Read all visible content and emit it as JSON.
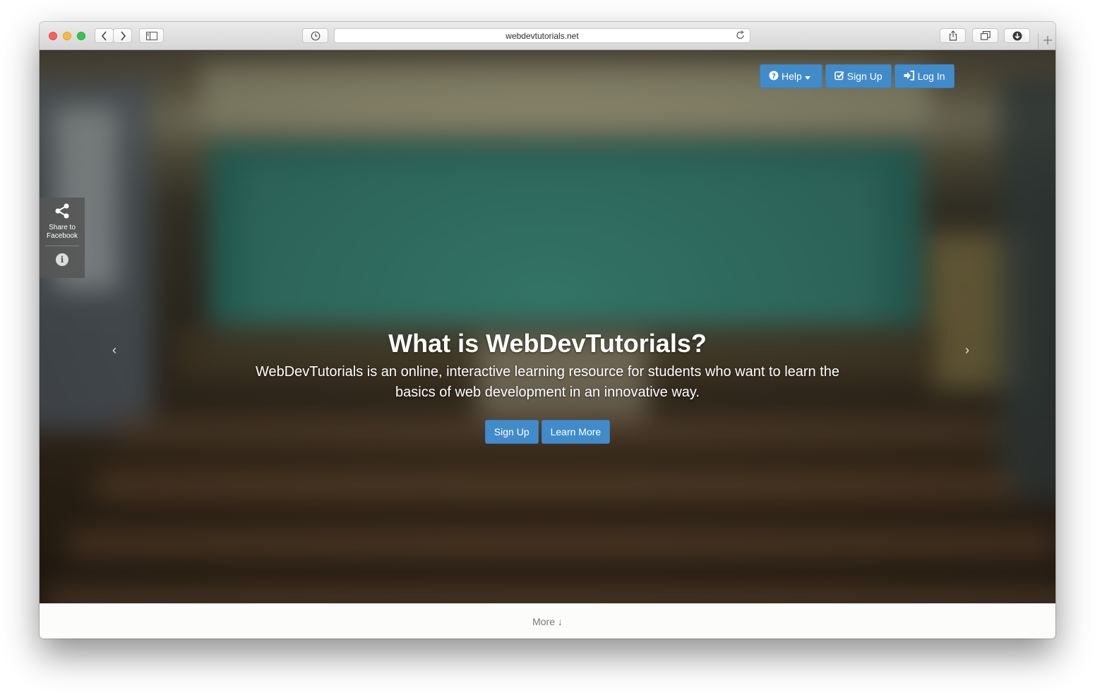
{
  "browser": {
    "url": "webdevtutorials.net",
    "traffic_lights": {
      "close": "#fc605c",
      "minimize": "#fdbc40",
      "zoom": "#34c84a"
    },
    "icons": [
      "back-icon",
      "forward-icon",
      "sidebar-icon",
      "history-icon",
      "reload-icon",
      "share-icon",
      "tabs-icon",
      "downloads-icon",
      "new-tab-icon"
    ]
  },
  "nav": {
    "help": "Help",
    "signup": "Sign Up",
    "login": "Log In"
  },
  "share": {
    "label_line1": "Share to",
    "label_line2": "Facebook",
    "info": "i"
  },
  "carousel": {
    "prev": "‹",
    "next": "›"
  },
  "hero": {
    "title": "What is WebDevTutorials?",
    "description": "WebDevTutorials is an online, interactive learning resource for students who want to learn the basics of web development in an innovative way.",
    "signup_button": "Sign Up",
    "learn_more_button": "Learn More"
  },
  "footer": {
    "more": "More ↓"
  },
  "colors": {
    "primary": "#428bca",
    "primary_border": "#357ebd"
  }
}
